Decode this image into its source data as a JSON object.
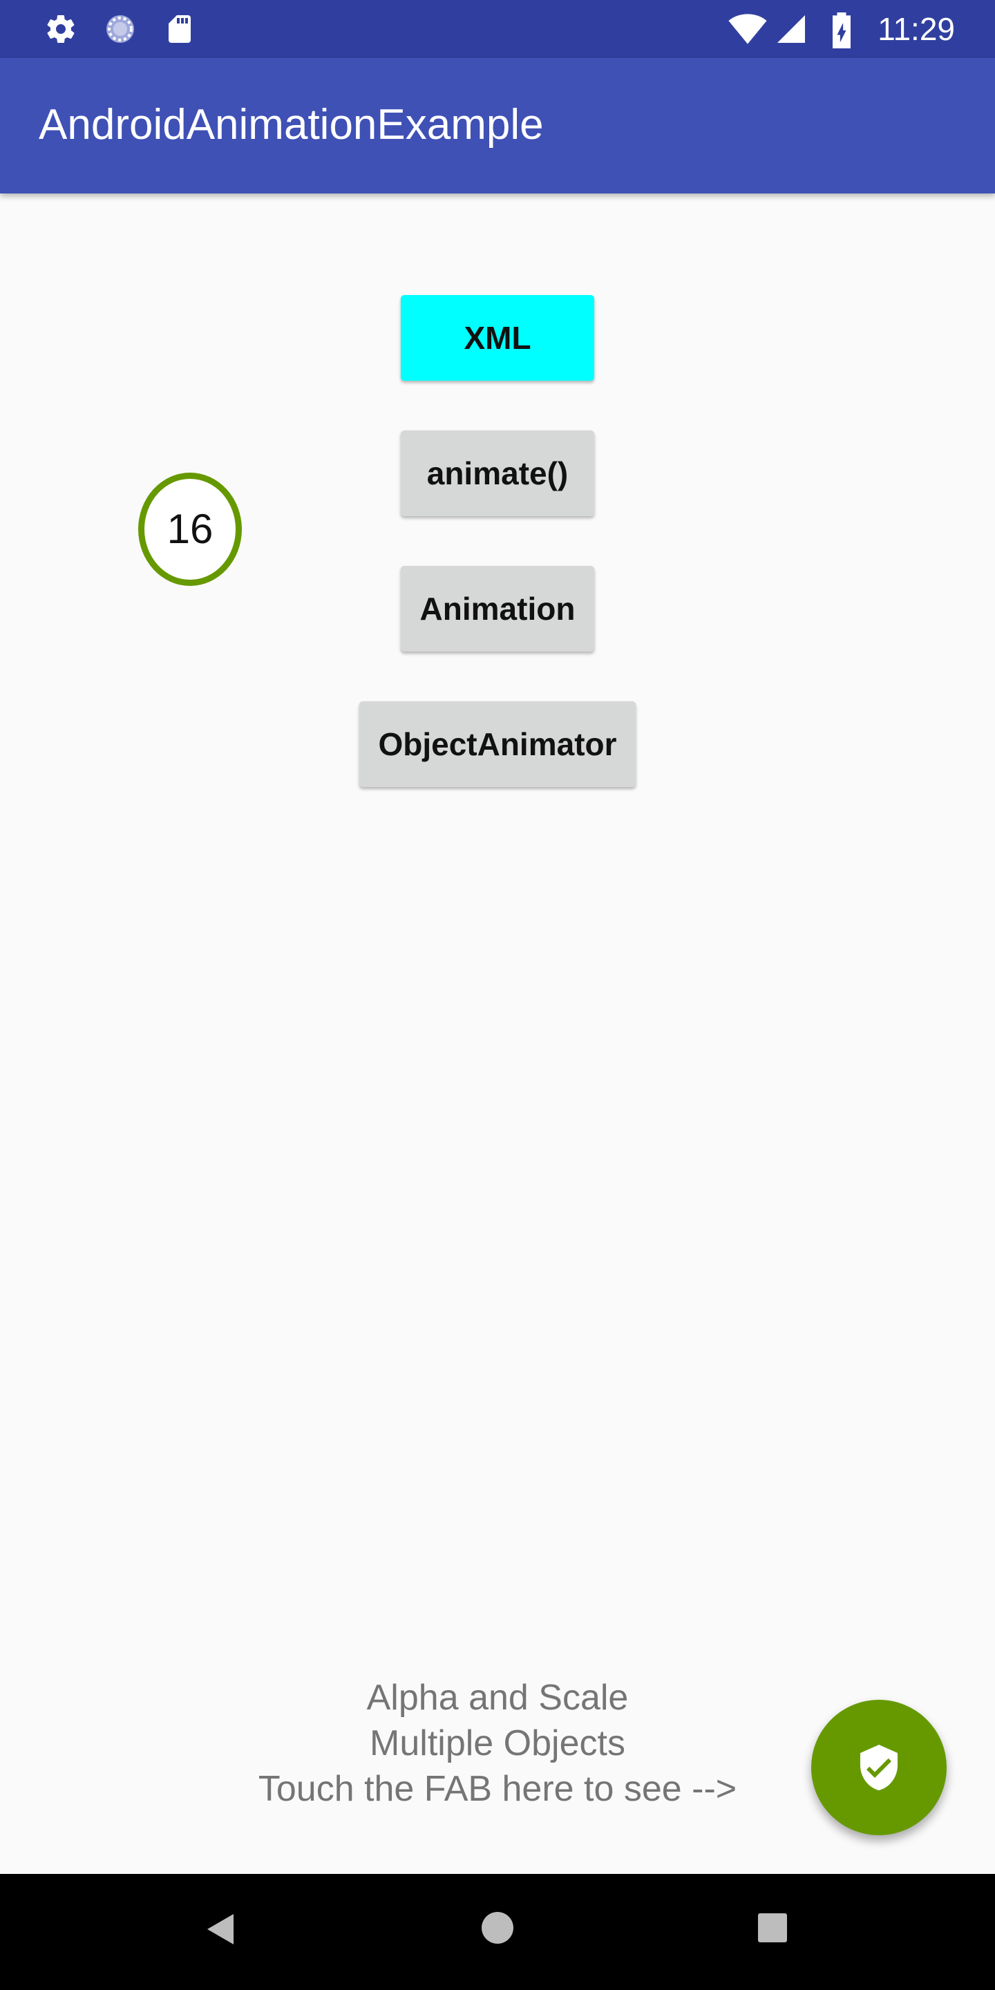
{
  "status_bar": {
    "time": "11:29",
    "left_icons": [
      "settings-icon",
      "sync-progress-icon",
      "sd-card-icon"
    ],
    "right_icons": [
      "wifi-icon",
      "cellular-signal-icon",
      "battery-charging-icon"
    ]
  },
  "app_bar": {
    "title": "AndroidAnimationExample"
  },
  "buttons": {
    "xml": "XML",
    "animate": "animate()",
    "animation": "Animation",
    "object_animator": "ObjectAnimator"
  },
  "counter": {
    "value": "16"
  },
  "instructions": {
    "line1": "Alpha and Scale",
    "line2": "Multiple Objects",
    "line3": "Touch the FAB here to see -->"
  },
  "fab": {
    "icon": "verified-shield-icon"
  },
  "navigation": {
    "icons": [
      "back-icon",
      "home-icon",
      "recents-icon"
    ]
  },
  "colors": {
    "status_bar": "#303f9f",
    "app_bar": "#3f51b5",
    "xml_button": "#00ffff",
    "default_button": "#d6d7d7",
    "accent_green": "#669900",
    "background": "#fafafa"
  }
}
